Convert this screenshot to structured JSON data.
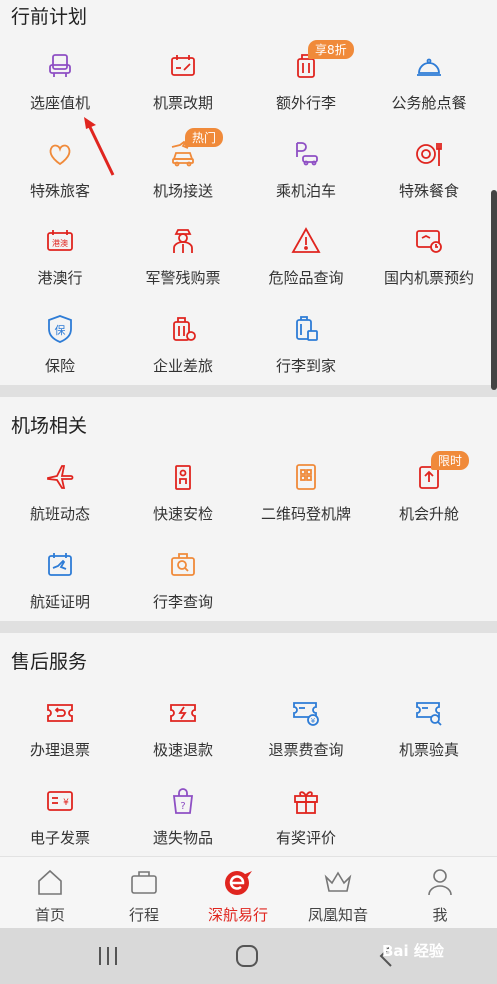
{
  "sections": [
    {
      "title": "行前计划",
      "items": [
        {
          "label": "选座值机",
          "icon": "seat-icon"
        },
        {
          "label": "机票改期",
          "icon": "ticket-change-icon"
        },
        {
          "label": "额外行李",
          "icon": "luggage-icon",
          "badge": "享8折"
        },
        {
          "label": "公务舱点餐",
          "icon": "dish-cover-icon"
        },
        {
          "label": "特殊旅客",
          "icon": "heart-icon"
        },
        {
          "label": "机场接送",
          "icon": "car-plane-icon",
          "badge": "热门"
        },
        {
          "label": "乘机泊车",
          "icon": "parking-icon"
        },
        {
          "label": "特殊餐食",
          "icon": "meal-icon"
        },
        {
          "label": "港澳行",
          "icon": "hk-macau-icon"
        },
        {
          "label": "军警残购票",
          "icon": "officer-icon"
        },
        {
          "label": "危险品查询",
          "icon": "warning-icon"
        },
        {
          "label": "国内机票预约",
          "icon": "ticket-clock-icon"
        },
        {
          "label": "保险",
          "icon": "shield-icon"
        },
        {
          "label": "企业差旅",
          "icon": "business-luggage-icon"
        },
        {
          "label": "行李到家",
          "icon": "luggage-home-icon"
        }
      ]
    },
    {
      "title": "机场相关",
      "items": [
        {
          "label": "航班动态",
          "icon": "plane-icon"
        },
        {
          "label": "快速安检",
          "icon": "security-check-icon"
        },
        {
          "label": "二维码登机牌",
          "icon": "qrcode-icon"
        },
        {
          "label": "机会升舱",
          "icon": "upgrade-icon",
          "badge": "限时"
        },
        {
          "label": "航延证明",
          "icon": "delay-cert-icon"
        },
        {
          "label": "行李查询",
          "icon": "luggage-search-icon"
        }
      ]
    },
    {
      "title": "售后服务",
      "items": [
        {
          "label": "办理退票",
          "icon": "refund-ticket-icon"
        },
        {
          "label": "极速退款",
          "icon": "fast-refund-icon"
        },
        {
          "label": "退票费查询",
          "icon": "refund-fee-icon"
        },
        {
          "label": "机票验真",
          "icon": "verify-ticket-icon"
        },
        {
          "label": "电子发票",
          "icon": "invoice-icon"
        },
        {
          "label": "遗失物品",
          "icon": "lost-item-icon"
        },
        {
          "label": "有奖评价",
          "icon": "gift-icon"
        }
      ]
    }
  ],
  "tabs": [
    {
      "label": "首页",
      "icon": "home-icon"
    },
    {
      "label": "行程",
      "icon": "suitcase-icon"
    },
    {
      "label": "深航易行",
      "icon": "airline-logo-icon",
      "active": true
    },
    {
      "label": "凤凰知音",
      "icon": "crown-icon"
    },
    {
      "label": "我",
      "icon": "person-icon"
    }
  ],
  "watermark": "Bai 经验",
  "colors": {
    "accent": "#e0251f",
    "badge": "#f08a3a",
    "purple": "#8e4fc4",
    "blue": "#2e7cd6"
  }
}
